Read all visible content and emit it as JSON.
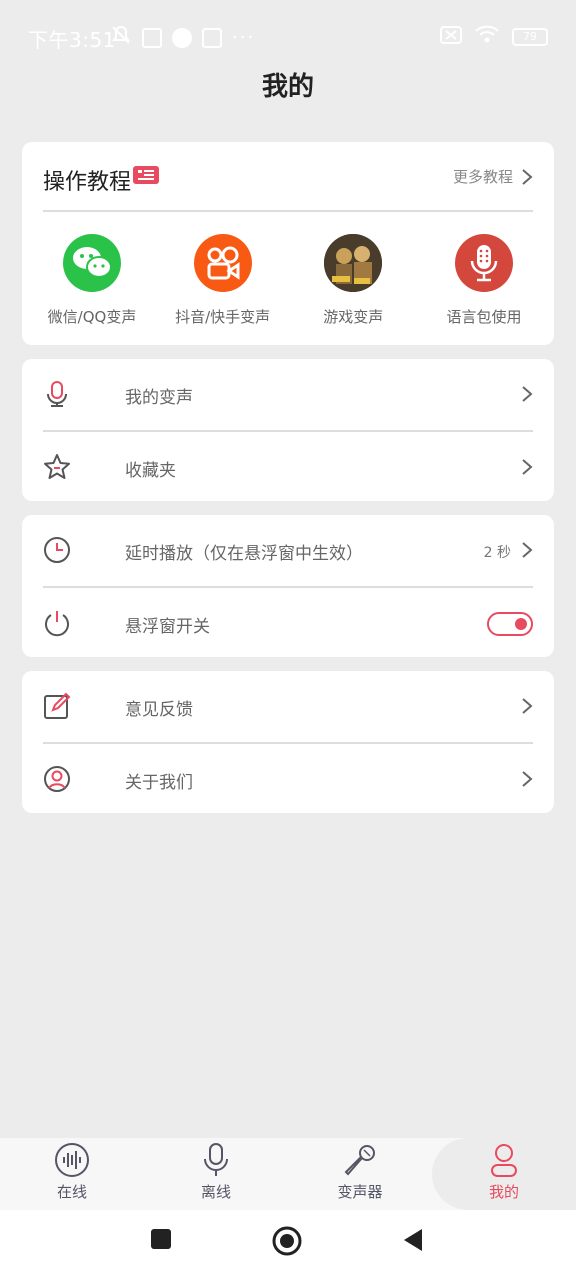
{
  "status_bar": {
    "time": "下午3:51",
    "battery": "79",
    "extra": "···"
  },
  "header": {
    "title": "我的"
  },
  "tutorial": {
    "title": "操作教程",
    "more": "更多教程",
    "items": [
      {
        "label": "微信/QQ变声",
        "icon": "wechat-icon",
        "color": "#2bc24a"
      },
      {
        "label": "抖音/快手变声",
        "icon": "kuaishou-icon",
        "color": "#f85a13"
      },
      {
        "label": "游戏变声",
        "icon": "game-icon",
        "color": "#7a5a2a"
      },
      {
        "label": "语言包使用",
        "icon": "voice-pack-icon",
        "color": "#d4473c"
      }
    ]
  },
  "menu_voice": {
    "my_voice": "我的变声",
    "favorites": "收藏夹"
  },
  "menu_delay": {
    "delay_label": "延时播放（仅在悬浮窗中生效）",
    "delay_value": "2 秒",
    "float_label": "悬浮窗开关",
    "float_on": true
  },
  "menu_about": {
    "feedback": "意见反馈",
    "about": "关于我们"
  },
  "tabs": [
    {
      "label": "在线",
      "icon": "waveform-icon"
    },
    {
      "label": "离线",
      "icon": "microphone-icon"
    },
    {
      "label": "变声器",
      "icon": "karaoke-mic-icon"
    },
    {
      "label": "我的",
      "icon": "user-icon",
      "active": true
    }
  ],
  "colors": {
    "accent": "#e84a5f",
    "background": "#ececec",
    "card": "#ffffff"
  }
}
